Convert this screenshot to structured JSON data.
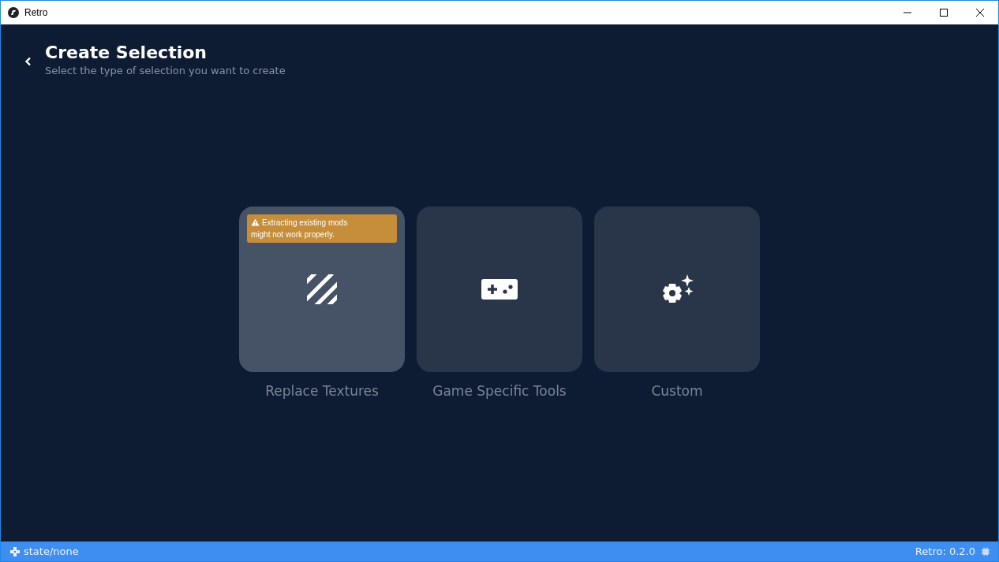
{
  "window": {
    "title": "Retro"
  },
  "header": {
    "title": "Create Selection",
    "subtitle": "Select the type of selection you want to create"
  },
  "options": [
    {
      "kind": "textures",
      "label": "Replace Textures",
      "selected": true,
      "warning": "Extracting existing mods might not work properly."
    },
    {
      "kind": "gamepad",
      "label": "Game Specific Tools",
      "selected": false
    },
    {
      "kind": "custom",
      "label": "Custom",
      "selected": false
    }
  ],
  "status_bar": {
    "state": "state/none",
    "version": "Retro: 0.2.0"
  }
}
